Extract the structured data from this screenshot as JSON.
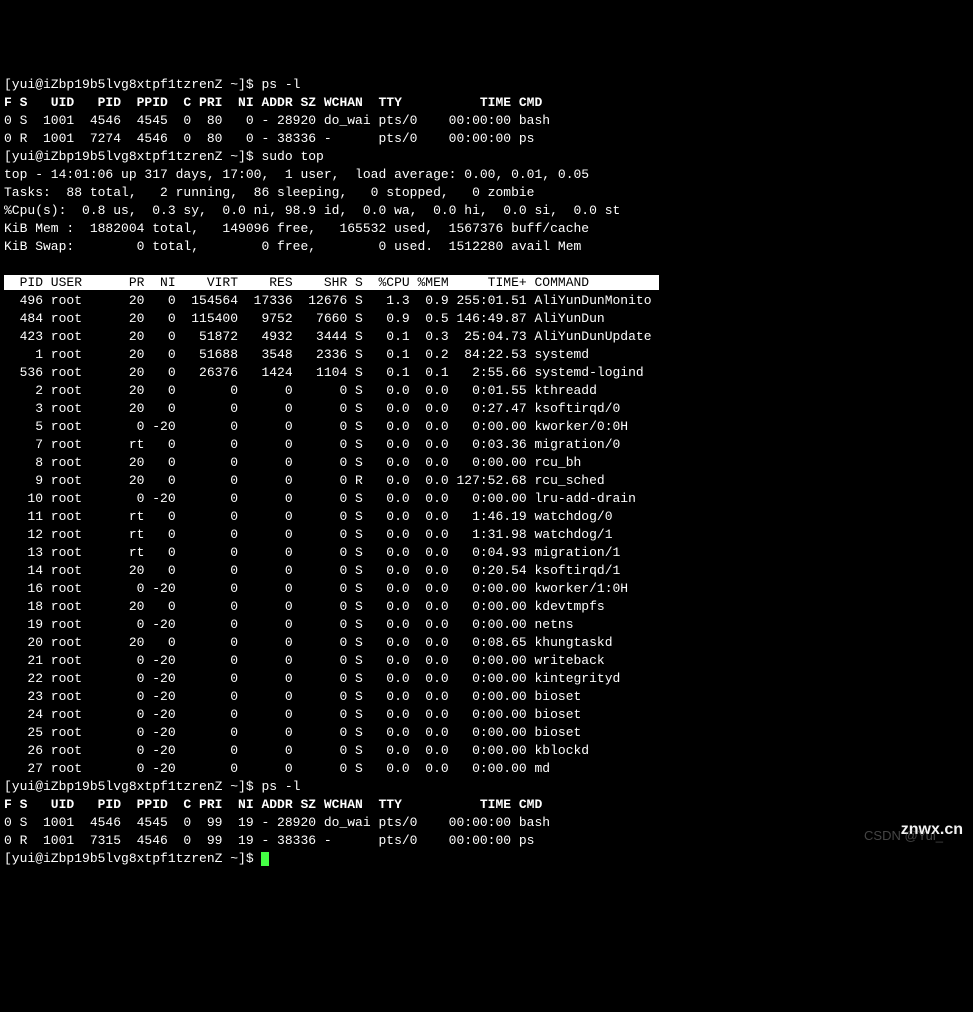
{
  "prompt1": "[yui@iZbp19b5lvg8xtpf1tzrenZ ~]$ ",
  "cmd1": "ps -l",
  "ps1_header": "F S   UID   PID  PPID  C PRI  NI ADDR SZ WCHAN  TTY          TIME CMD",
  "ps1_rows": [
    "0 S  1001  4546  4545  0  80   0 - 28920 do_wai pts/0    00:00:00 bash",
    "0 R  1001  7274  4546  0  80   0 - 38336 -      pts/0    00:00:00 ps"
  ],
  "prompt2": "[yui@iZbp19b5lvg8xtpf1tzrenZ ~]$ ",
  "cmd2": "sudo top",
  "top_summary": [
    "top - 14:01:06 up 317 days, 17:00,  1 user,  load average: 0.00, 0.01, 0.05",
    "Tasks:  88 total,   2 running,  86 sleeping,   0 stopped,   0 zombie",
    "%Cpu(s):  0.8 us,  0.3 sy,  0.0 ni, 98.9 id,  0.0 wa,  0.0 hi,  0.0 si,  0.0 st",
    "KiB Mem :  1882004 total,   149096 free,   165532 used,  1567376 buff/cache",
    "KiB Swap:        0 total,        0 free,        0 used.  1512280 avail Mem"
  ],
  "top_header": "  PID USER      PR  NI    VIRT    RES    SHR S  %CPU %MEM     TIME+ COMMAND         ",
  "top_rows": [
    "  496 root      20   0  154564  17336  12676 S   1.3  0.9 255:01.51 AliYunDunMonito",
    "  484 root      20   0  115400   9752   7660 S   0.9  0.5 146:49.87 AliYunDun",
    "  423 root      20   0   51872   4932   3444 S   0.1  0.3  25:04.73 AliYunDunUpdate",
    "    1 root      20   0   51688   3548   2336 S   0.1  0.2  84:22.53 systemd",
    "  536 root      20   0   26376   1424   1104 S   0.1  0.1   2:55.66 systemd-logind",
    "    2 root      20   0       0      0      0 S   0.0  0.0   0:01.55 kthreadd",
    "    3 root      20   0       0      0      0 S   0.0  0.0   0:27.47 ksoftirqd/0",
    "    5 root       0 -20       0      0      0 S   0.0  0.0   0:00.00 kworker/0:0H",
    "    7 root      rt   0       0      0      0 S   0.0  0.0   0:03.36 migration/0",
    "    8 root      20   0       0      0      0 S   0.0  0.0   0:00.00 rcu_bh",
    "    9 root      20   0       0      0      0 R   0.0  0.0 127:52.68 rcu_sched",
    "   10 root       0 -20       0      0      0 S   0.0  0.0   0:00.00 lru-add-drain",
    "   11 root      rt   0       0      0      0 S   0.0  0.0   1:46.19 watchdog/0",
    "   12 root      rt   0       0      0      0 S   0.0  0.0   1:31.98 watchdog/1",
    "   13 root      rt   0       0      0      0 S   0.0  0.0   0:04.93 migration/1",
    "   14 root      20   0       0      0      0 S   0.0  0.0   0:20.54 ksoftirqd/1",
    "   16 root       0 -20       0      0      0 S   0.0  0.0   0:00.00 kworker/1:0H",
    "   18 root      20   0       0      0      0 S   0.0  0.0   0:00.00 kdevtmpfs",
    "   19 root       0 -20       0      0      0 S   0.0  0.0   0:00.00 netns",
    "   20 root      20   0       0      0      0 S   0.0  0.0   0:08.65 khungtaskd",
    "   21 root       0 -20       0      0      0 S   0.0  0.0   0:00.00 writeback",
    "   22 root       0 -20       0      0      0 S   0.0  0.0   0:00.00 kintegrityd",
    "   23 root       0 -20       0      0      0 S   0.0  0.0   0:00.00 bioset",
    "   24 root       0 -20       0      0      0 S   0.0  0.0   0:00.00 bioset",
    "   25 root       0 -20       0      0      0 S   0.0  0.0   0:00.00 bioset",
    "   26 root       0 -20       0      0      0 S   0.0  0.0   0:00.00 kblockd",
    "   27 root       0 -20       0      0      0 S   0.0  0.0   0:00.00 md"
  ],
  "prompt3": "[yui@iZbp19b5lvg8xtpf1tzrenZ ~]$ ",
  "cmd3": "ps -l",
  "ps2_header": "F S   UID   PID  PPID  C PRI  NI ADDR SZ WCHAN  TTY          TIME CMD",
  "ps2_rows": [
    "0 S  1001  4546  4545  0  99  19 - 28920 do_wai pts/0    00:00:00 bash",
    "0 R  1001  7315  4546  0  99  19 - 38336 -      pts/0    00:00:00 ps"
  ],
  "prompt4": "[yui@iZbp19b5lvg8xtpf1tzrenZ ~]$ ",
  "watermark1": "znwx.cn",
  "watermark2": "CSDN @Yui_"
}
